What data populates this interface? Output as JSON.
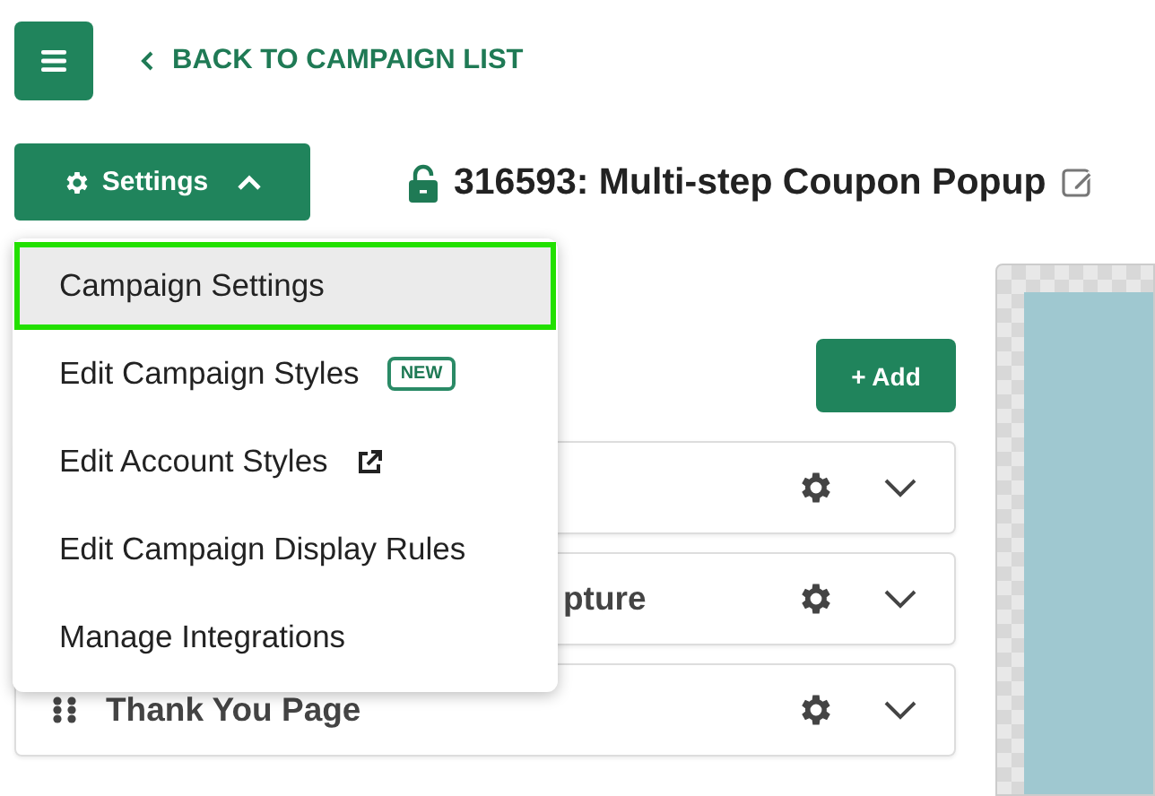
{
  "header": {
    "back_link": "BACK TO CAMPAIGN LIST"
  },
  "settings_button": {
    "label": "Settings",
    "expanded": true
  },
  "campaign": {
    "title": "316593: Multi-step Coupon Popup",
    "locked": false
  },
  "dropdown": [
    {
      "label": "Campaign Settings",
      "selected": true
    },
    {
      "label": "Edit Campaign Styles",
      "selected": false,
      "badge": "NEW"
    },
    {
      "label": "Edit Account Styles",
      "selected": false,
      "external": true
    },
    {
      "label": "Edit Campaign Display Rules",
      "selected": false
    },
    {
      "label": "Manage Integrations",
      "selected": false
    }
  ],
  "add_button": "+ Add",
  "steps": [
    {
      "kind": "hidden"
    },
    {
      "kind": "partial",
      "label": "pture"
    },
    {
      "kind": "full",
      "label": "Thank You Page"
    }
  ]
}
